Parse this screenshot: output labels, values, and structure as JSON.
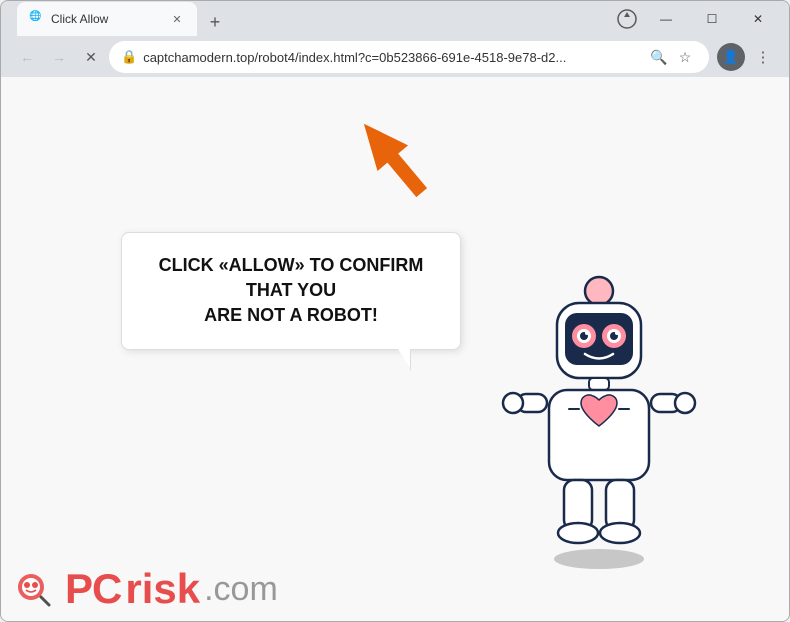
{
  "browser": {
    "tab": {
      "title": "Click Allow",
      "favicon": "🌐"
    },
    "new_tab_label": "+",
    "window_controls": {
      "minimize": "—",
      "maximize": "☐",
      "close": "✕"
    },
    "nav": {
      "back": "←",
      "forward": "→",
      "reload": "✕"
    },
    "url": "captchamodern.top/robot4/index.html?c=0b523866-691e-4518-9e78-d2...",
    "lock_icon": "🔒",
    "url_actions": {
      "search": "🔍",
      "star": "☆"
    },
    "toolbar": {
      "profile": "👤",
      "menu": "⋮"
    }
  },
  "page": {
    "bubble_text_line1": "CLICK «ALLOW» TO CONFIRM THAT YOU",
    "bubble_text_line2": "ARE NOT A ROBOT!",
    "watermark": {
      "pc": "PC",
      "risk": "risk",
      "domain": ".com"
    }
  },
  "colors": {
    "orange_arrow": "#e8640a",
    "bubble_border": "#dddddd",
    "pc_red": "#e63030",
    "risk_gray": "#888888"
  }
}
